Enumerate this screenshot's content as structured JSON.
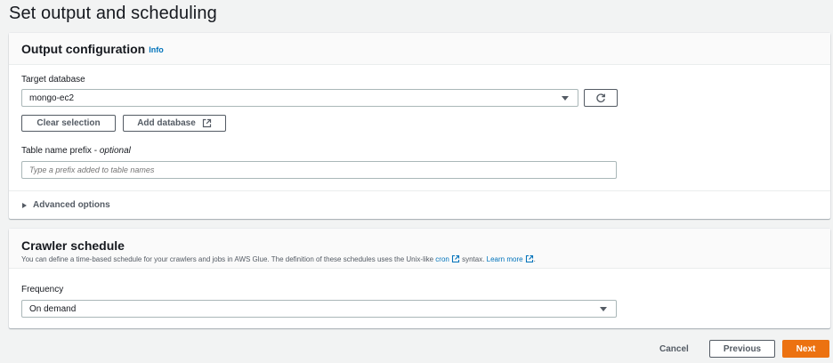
{
  "page": {
    "title": "Set output and scheduling"
  },
  "output_config": {
    "title": "Output configuration",
    "info_label": "Info",
    "target_database": {
      "label": "Target database",
      "value": "mongo-ec2"
    },
    "clear_selection_label": "Clear selection",
    "add_database_label": "Add database",
    "table_prefix": {
      "label": "Table name prefix - ",
      "label_optional": "optional",
      "value": "",
      "placeholder": "Type a prefix added to table names"
    },
    "advanced_options_label": "Advanced options"
  },
  "crawler_schedule": {
    "title": "Crawler schedule",
    "description_before": "You can define a time-based schedule for your crawlers and jobs in AWS Glue. The definition of these schedules uses the Unix-like ",
    "cron_link": "cron",
    "description_mid": " syntax. ",
    "learn_more_link": "Learn more",
    "description_end": ".",
    "frequency": {
      "label": "Frequency",
      "value": "On demand"
    }
  },
  "footer": {
    "cancel_label": "Cancel",
    "previous_label": "Previous",
    "next_label": "Next"
  },
  "colors": {
    "accent": "#ec7211",
    "link": "#0073bb",
    "background": "#f2f3f3"
  },
  "icons": {
    "refresh": "refresh-icon",
    "external": "external-link-icon",
    "dropdown": "caret-down-icon",
    "expand": "caret-right-icon"
  }
}
